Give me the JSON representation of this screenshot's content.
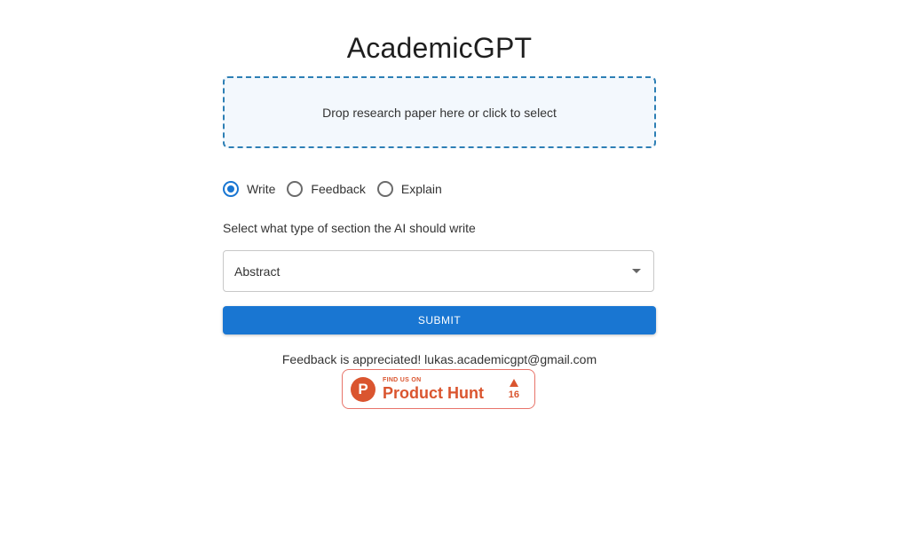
{
  "app": {
    "title": "AcademicGPT"
  },
  "dropzone": {
    "text": "Drop research paper here or click to select"
  },
  "mode": {
    "options": [
      {
        "label": "Write",
        "checked": true
      },
      {
        "label": "Feedback",
        "checked": false
      },
      {
        "label": "Explain",
        "checked": false
      }
    ]
  },
  "section": {
    "helper": "Select what type of section the AI should write",
    "selected": "Abstract"
  },
  "submit": {
    "label": "SUBMIT"
  },
  "footer": {
    "feedback": "Feedback is appreciated! lukas.academicgpt@gmail.com"
  },
  "producthunt": {
    "logo_letter": "P",
    "small_text": "FIND US ON",
    "name": "Product Hunt",
    "votes": "16"
  },
  "colors": {
    "accent": "#1976d2",
    "dropzone_border": "#2d7fb5",
    "producthunt": "#da552f"
  }
}
